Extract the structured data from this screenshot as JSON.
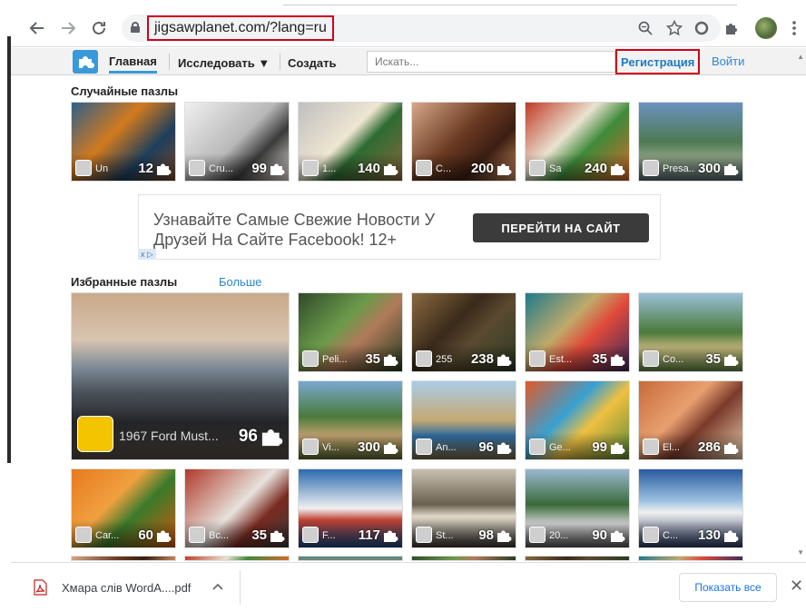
{
  "browser": {
    "url": "jigsawplanet.com/?lang=ru",
    "icons": [
      "back-arrow-icon",
      "forward-arrow-icon",
      "reload-icon",
      "lock-icon",
      "zoom-icon",
      "star-icon",
      "extension-icon",
      "puzzle-extension-icon",
      "menu-dots-icon"
    ]
  },
  "nav": {
    "home": "Главная",
    "explore": "Исследовать ▼",
    "create": "Создать",
    "search_placeholder": "Искать...",
    "register": "Регистрация",
    "login": "Войти"
  },
  "random": {
    "title": "Случайные пазлы",
    "tiles": [
      {
        "name": "Un",
        "pieces": "12"
      },
      {
        "name": "Cru...",
        "pieces": "99"
      },
      {
        "name": "1...",
        "pieces": "140"
      },
      {
        "name": "C...",
        "pieces": "200"
      },
      {
        "name": "Sa",
        "pieces": "240"
      },
      {
        "name": "Presa...",
        "pieces": "300"
      }
    ]
  },
  "ad": {
    "text": "Узнавайте Самые Свежие Новости У Друзей На Сайте Facebook! 12+",
    "button": "ПЕРЕЙТИ НА САЙТ",
    "close": "x ▷"
  },
  "featured": {
    "title": "Избранные пазлы",
    "more": "Больше",
    "big": {
      "name": "1967 Ford Must...",
      "pieces": "96"
    },
    "tiles": [
      {
        "name": "Peli...",
        "pieces": "35"
      },
      {
        "name": "255",
        "pieces": "238"
      },
      {
        "name": "Est...",
        "pieces": "35"
      },
      {
        "name": "Co...",
        "pieces": "35"
      },
      {
        "name": "Vi...",
        "pieces": "300"
      },
      {
        "name": "An...",
        "pieces": "96"
      },
      {
        "name": "Ge...",
        "pieces": "99"
      },
      {
        "name": "El...",
        "pieces": "286"
      },
      {
        "name": "Car...",
        "pieces": "60"
      },
      {
        "name": "Bc...",
        "pieces": "35"
      },
      {
        "name": "F...",
        "pieces": "117"
      },
      {
        "name": "St...",
        "pieces": "98"
      },
      {
        "name": "20...",
        "pieces": "90"
      },
      {
        "name": "C...",
        "pieces": "130"
      }
    ]
  },
  "download": {
    "filename": "Хмара слів WordA....pdf",
    "chevron": "^",
    "show_all": "Показать все",
    "close": "✕"
  }
}
